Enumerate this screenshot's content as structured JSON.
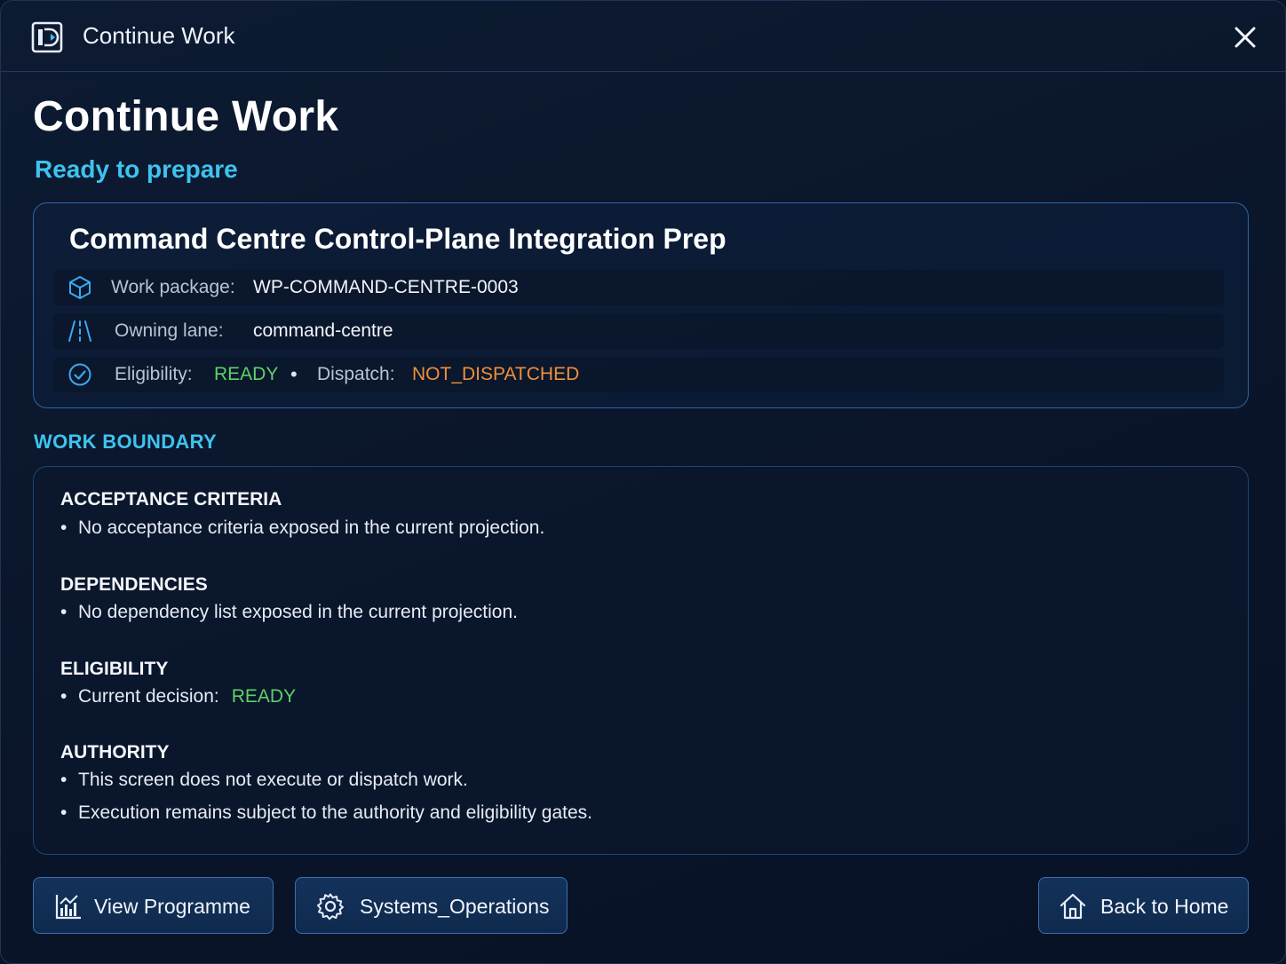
{
  "window": {
    "title": "Continue Work"
  },
  "header": {
    "title": "Continue Work",
    "subtitle": "Ready to prepare"
  },
  "summary": {
    "title": "Command Centre Control-Plane Integration Prep",
    "work_package_label": "Work package:",
    "work_package_value": "WP-COMMAND-CENTRE-0003",
    "owning_lane_label": "Owning lane:",
    "owning_lane_value": "command-centre",
    "eligibility_label": "Eligibility:",
    "eligibility_value": "READY",
    "separator": "•",
    "dispatch_label": "Dispatch:",
    "dispatch_value": "NOT_DISPATCHED"
  },
  "boundary": {
    "heading": "WORK BOUNDARY",
    "acceptance_heading": "ACCEPTANCE CRITERIA",
    "acceptance_item": "No acceptance criteria exposed in the current projection.",
    "dependencies_heading": "DEPENDENCIES",
    "dependencies_item": "No dependency list exposed in the current projection.",
    "eligibility_heading": "ELIGIBILITY",
    "eligibility_item_label": "Current decision:",
    "eligibility_item_value": "READY",
    "authority_heading": "AUTHORITY",
    "authority_items": [
      "This screen does not execute or dispatch work.",
      "Execution remains subject to the authority and eligibility gates."
    ],
    "bullet": "•"
  },
  "actions": {
    "view_programme": "View Programme",
    "systems_operations": "Systems_Operations",
    "back_home": "Back to Home"
  },
  "colors": {
    "accent": "#3fc3ee",
    "ready": "#5ed16a",
    "not_dispatched": "#f0903a",
    "card_border": "#2e63a6"
  },
  "icons": {
    "app": "app-window-icon",
    "close": "close-icon",
    "package": "cube-icon",
    "lane": "road-lane-icon",
    "check": "check-circle-icon",
    "chart": "bar-chart-icon",
    "gear": "gear-icon",
    "home": "home-icon"
  }
}
